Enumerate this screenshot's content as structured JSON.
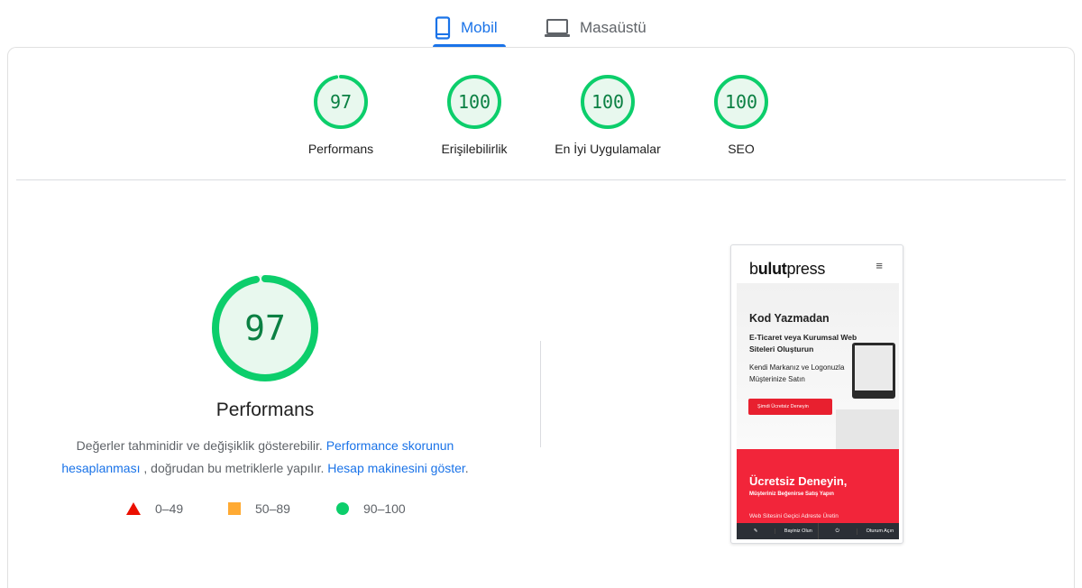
{
  "tabs": [
    {
      "label": "Mobil",
      "icon": "smartphone-icon",
      "active": true
    },
    {
      "label": "Masaüstü",
      "icon": "laptop-icon",
      "active": false
    }
  ],
  "colors": {
    "accent": "#1a73e8",
    "pass": "#0cce6b",
    "pass_text": "#0b8043",
    "average": "#ffaa33",
    "fail": "#eb0f00"
  },
  "categories": [
    {
      "label": "Performans",
      "score": "97",
      "value": 97
    },
    {
      "label": "Erişilebilirlik",
      "score": "100",
      "value": 100
    },
    {
      "label": "En İyi Uygulamalar",
      "score": "100",
      "value": 100
    },
    {
      "label": "SEO",
      "score": "100",
      "value": 100
    }
  ],
  "main": {
    "score": "97",
    "value": 97,
    "title": "Performans",
    "desc_pre": "Değerler tahminidir ve değişiklik gösterebilir. ",
    "link1": "Performance skorunun hesaplanması",
    "desc_mid": " , doğrudan bu metriklerle yapılır. ",
    "link2": "Hesap makinesini göster",
    "desc_end": "."
  },
  "legend": [
    {
      "range": "0–49",
      "icon": "triangle-icon"
    },
    {
      "range": "50–89",
      "icon": "square-icon"
    },
    {
      "range": "90–100",
      "icon": "circle-icon"
    }
  ],
  "screenshot": {
    "logo_prefix": "b",
    "logo_bold": "ulut",
    "logo_rest": "press",
    "menu": "≡",
    "heading": "Kod Yazmadan",
    "subheading": "E-Ticaret veya Kurumsal Web Siteleri Oluşturun",
    "text": "Kendi Markanız ve Logonuzla Müşterinize Satın",
    "cta": "Şimdi Ücretsiz Deneyin",
    "red_title": "Ücretsiz Deneyin,",
    "red_sub": "Müşteriniz Beğenirse Satış Yapın",
    "red_small": "Web Sitesini Geçici Adreste Üretin",
    "footer_left": "Bayiniz Olun",
    "footer_right": "Oturum Açın"
  }
}
